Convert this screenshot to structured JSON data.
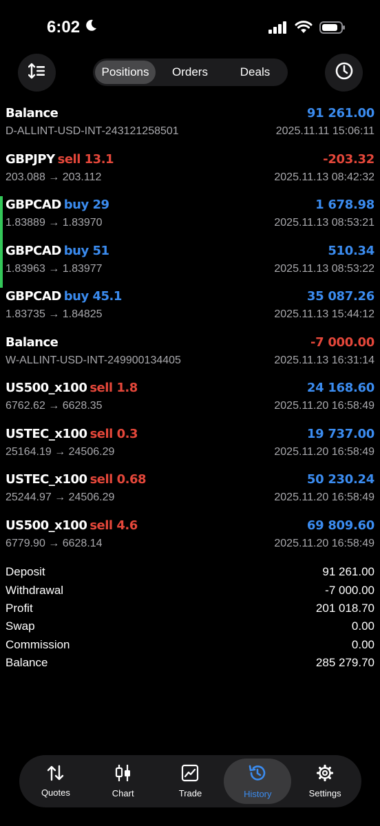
{
  "status_bar": {
    "time": "6:02"
  },
  "toolbar": {
    "tabs": [
      {
        "label": "Positions",
        "active": true
      },
      {
        "label": "Orders",
        "active": false
      },
      {
        "label": "Deals",
        "active": false
      }
    ]
  },
  "colors": {
    "positive": "#3b8cf0",
    "negative": "#e4473a",
    "accent_bar": "#34c759"
  },
  "rows": [
    {
      "symbol": "Balance",
      "action": "",
      "side": "",
      "amount": "91 261.00",
      "sign": "pos",
      "detail": "D-ALLINT-USD-INT-243121258501",
      "time": "2025.11.11 15:06:11",
      "marked": false
    },
    {
      "symbol": "GBPJPY",
      "action": "sell 13.1",
      "side": "sell",
      "amount": "-203.32",
      "sign": "neg",
      "detail": "203.088 → 203.112",
      "time": "2025.11.13 08:42:32",
      "marked": false
    },
    {
      "symbol": "GBPCAD",
      "action": "buy 29",
      "side": "buy",
      "amount": "1 678.98",
      "sign": "pos",
      "detail": "1.83889 → 1.83970",
      "time": "2025.11.13 08:53:21",
      "marked": true
    },
    {
      "symbol": "GBPCAD",
      "action": "buy 51",
      "side": "buy",
      "amount": "510.34",
      "sign": "pos",
      "detail": "1.83963 → 1.83977",
      "time": "2025.11.13 08:53:22",
      "marked": true
    },
    {
      "symbol": "GBPCAD",
      "action": "buy 45.1",
      "side": "buy",
      "amount": "35 087.26",
      "sign": "pos",
      "detail": "1.83735 → 1.84825",
      "time": "2025.11.13 15:44:12",
      "marked": false
    },
    {
      "symbol": "Balance",
      "action": "",
      "side": "",
      "amount": "-7 000.00",
      "sign": "neg",
      "detail": "W-ALLINT-USD-INT-249900134405",
      "time": "2025.11.13 16:31:14",
      "marked": false
    },
    {
      "symbol": "US500_x100",
      "action": "sell 1.8",
      "side": "sell",
      "amount": "24 168.60",
      "sign": "pos",
      "detail": "6762.62 → 6628.35",
      "time": "2025.11.20 16:58:49",
      "marked": false
    },
    {
      "symbol": "USTEC_x100",
      "action": "sell 0.3",
      "side": "sell",
      "amount": "19 737.00",
      "sign": "pos",
      "detail": "25164.19 → 24506.29",
      "time": "2025.11.20 16:58:49",
      "marked": false
    },
    {
      "symbol": "USTEC_x100",
      "action": "sell 0.68",
      "side": "sell",
      "amount": "50 230.24",
      "sign": "pos",
      "detail": "25244.97 → 24506.29",
      "time": "2025.11.20 16:58:49",
      "marked": false
    },
    {
      "symbol": "US500_x100",
      "action": "sell 4.6",
      "side": "sell",
      "amount": "69 809.60",
      "sign": "pos",
      "detail": "6779.90 → 6628.14",
      "time": "2025.11.20 16:58:49",
      "marked": false
    }
  ],
  "summary": [
    {
      "label": "Deposit",
      "value": "91 261.00"
    },
    {
      "label": "Withdrawal",
      "value": "-7 000.00"
    },
    {
      "label": "Profit",
      "value": "201 018.70"
    },
    {
      "label": "Swap",
      "value": "0.00"
    },
    {
      "label": "Commission",
      "value": "0.00"
    },
    {
      "label": "Balance",
      "value": "285 279.70"
    }
  ],
  "nav": [
    {
      "label": "Quotes",
      "icon": "quotes-arrows-icon",
      "active": false
    },
    {
      "label": "Chart",
      "icon": "candlestick-icon",
      "active": false
    },
    {
      "label": "Trade",
      "icon": "trade-chart-icon",
      "active": false
    },
    {
      "label": "History",
      "icon": "history-clock-icon",
      "active": true
    },
    {
      "label": "Settings",
      "icon": "gear-icon",
      "active": false
    }
  ]
}
